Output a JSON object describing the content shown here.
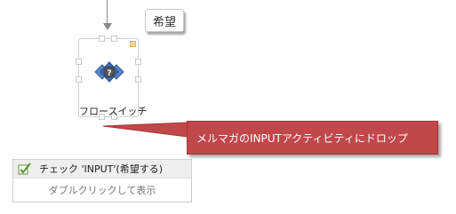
{
  "bubble": {
    "label": "希望"
  },
  "flow_switch": {
    "label": "フロースイッチ"
  },
  "callout": {
    "text": "メルマガのINPUTアクティビティにドロップ"
  },
  "activity": {
    "title": "チェック 'INPUT'(希望する)",
    "hint": "ダブルクリックして表示"
  },
  "colors": {
    "callout": "#c0474a",
    "node_icon": "#2f5ea6"
  }
}
